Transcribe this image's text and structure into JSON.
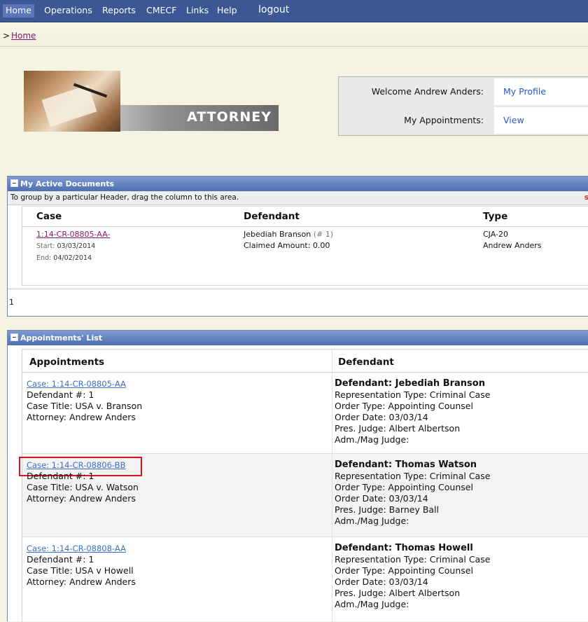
{
  "menu": {
    "items": [
      "Home",
      "Operations",
      "Reports",
      "CMECF",
      "Links",
      "Help"
    ],
    "logout": "logout"
  },
  "breadcrumb": {
    "separator": ">",
    "home": "Home"
  },
  "banner": {
    "title": "ATTORNEY"
  },
  "welcome": {
    "greeting_label": "Welcome Andrew Anders:",
    "profile_link": "My Profile",
    "appointments_label": "My Appointments:",
    "view_link": "View"
  },
  "active_documents": {
    "title": "My Active Documents",
    "grouping_hint": "To group by a particular Header, drag the column to this area.",
    "grouping_edge_glyph": "s",
    "columns": [
      "Case",
      "Defendant",
      "Type"
    ],
    "rows": [
      {
        "case": "1:14-CR-08805-AA-",
        "start_label": "Start:",
        "start": "03/03/2014",
        "end_label": "End:",
        "end": "04/02/2014",
        "defendant": "Jebediah Branson",
        "defendant_num": "(# 1)",
        "claimed": "Claimed Amount: 0.00",
        "type": "CJA-20",
        "type_attorney": "Andrew Anders"
      }
    ],
    "page": "1"
  },
  "appointments": {
    "title": "Appointments' List",
    "columns": [
      "Appointments",
      "Defendant"
    ],
    "rows": [
      {
        "case_link": "Case: 1:14-CR-08805-AA",
        "defendant_num": "Defendant #: 1",
        "case_title": "Case Title: USA v. Branson",
        "attorney": "Attorney: Andrew Anders",
        "defendant": "Defendant: Jebediah Branson",
        "rep_type": "Representation Type: Criminal Case",
        "order_type": "Order Type: Appointing Counsel",
        "order_date": "Order Date: 03/03/14",
        "pres_judge": "Pres. Judge: Albert Albertson",
        "mag_judge": "Adm./Mag Judge:"
      },
      {
        "case_link": "Case: 1:14-CR-08806-BB",
        "defendant_num": "Defendant #: 1",
        "case_title": "Case Title: USA v. Watson",
        "attorney": "Attorney: Andrew Anders",
        "defendant": "Defendant: Thomas Watson",
        "rep_type": "Representation Type: Criminal Case",
        "order_type": "Order Type: Appointing Counsel",
        "order_date": "Order Date: 03/03/14",
        "pres_judge": "Pres. Judge: Barney Ball",
        "mag_judge": "Adm./Mag Judge:"
      },
      {
        "case_link": "Case: 1:14-CR-08808-AA",
        "defendant_num": "Defendant #: 1",
        "case_title": "Case Title: USA v Howell",
        "attorney": "Attorney: Andrew Anders",
        "defendant": "Defendant: Thomas Howell",
        "rep_type": "Representation Type: Criminal Case",
        "order_type": "Order Type: Appointing Counsel",
        "order_date": "Order Date: 03/03/14",
        "pres_judge": "Pres. Judge: Albert Albertson",
        "mag_judge": "Adm./Mag Judge:"
      }
    ]
  },
  "colors": {
    "menu_bg": "#3b5895",
    "panel_header": "#5b7bbd",
    "case_link": "#801a6e",
    "link": "#3b6fc2",
    "highlight_box": "#d9141b"
  }
}
